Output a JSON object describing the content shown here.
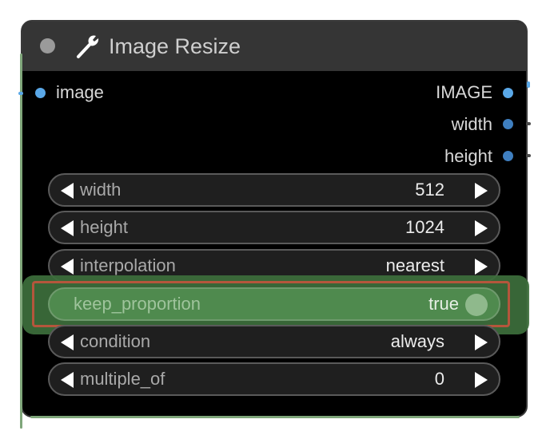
{
  "node": {
    "title": "Image Resize",
    "header_icon": "wrench-icon",
    "collapse_icon": "collapse-dot-icon"
  },
  "inputs": [
    {
      "label": "image",
      "color": "#5aa8e8"
    }
  ],
  "outputs": [
    {
      "label": "IMAGE",
      "color": "#5aa8e8"
    },
    {
      "label": "width",
      "color": "#3f7fc0"
    },
    {
      "label": "height",
      "color": "#3f7fc0"
    }
  ],
  "widgets": [
    {
      "label": "width",
      "value": "512"
    },
    {
      "label": "height",
      "value": "1024"
    },
    {
      "label": "interpolation",
      "value": "nearest"
    },
    {
      "label": "keep_proportion",
      "value": "true",
      "type": "toggle",
      "state": true
    },
    {
      "label": "condition",
      "value": "always"
    },
    {
      "label": "multiple_of",
      "value": "0"
    }
  ],
  "colors": {
    "node_bg": "#000000",
    "header_bg": "#353535",
    "widget_bg": "#1f1f1f",
    "widget_border": "#5a5a5a",
    "highlight_green": "#3d6f3c",
    "highlight_frame": "#b5563c",
    "slot_image": "#5aa8e8",
    "slot_int": "#3f7fc0"
  }
}
